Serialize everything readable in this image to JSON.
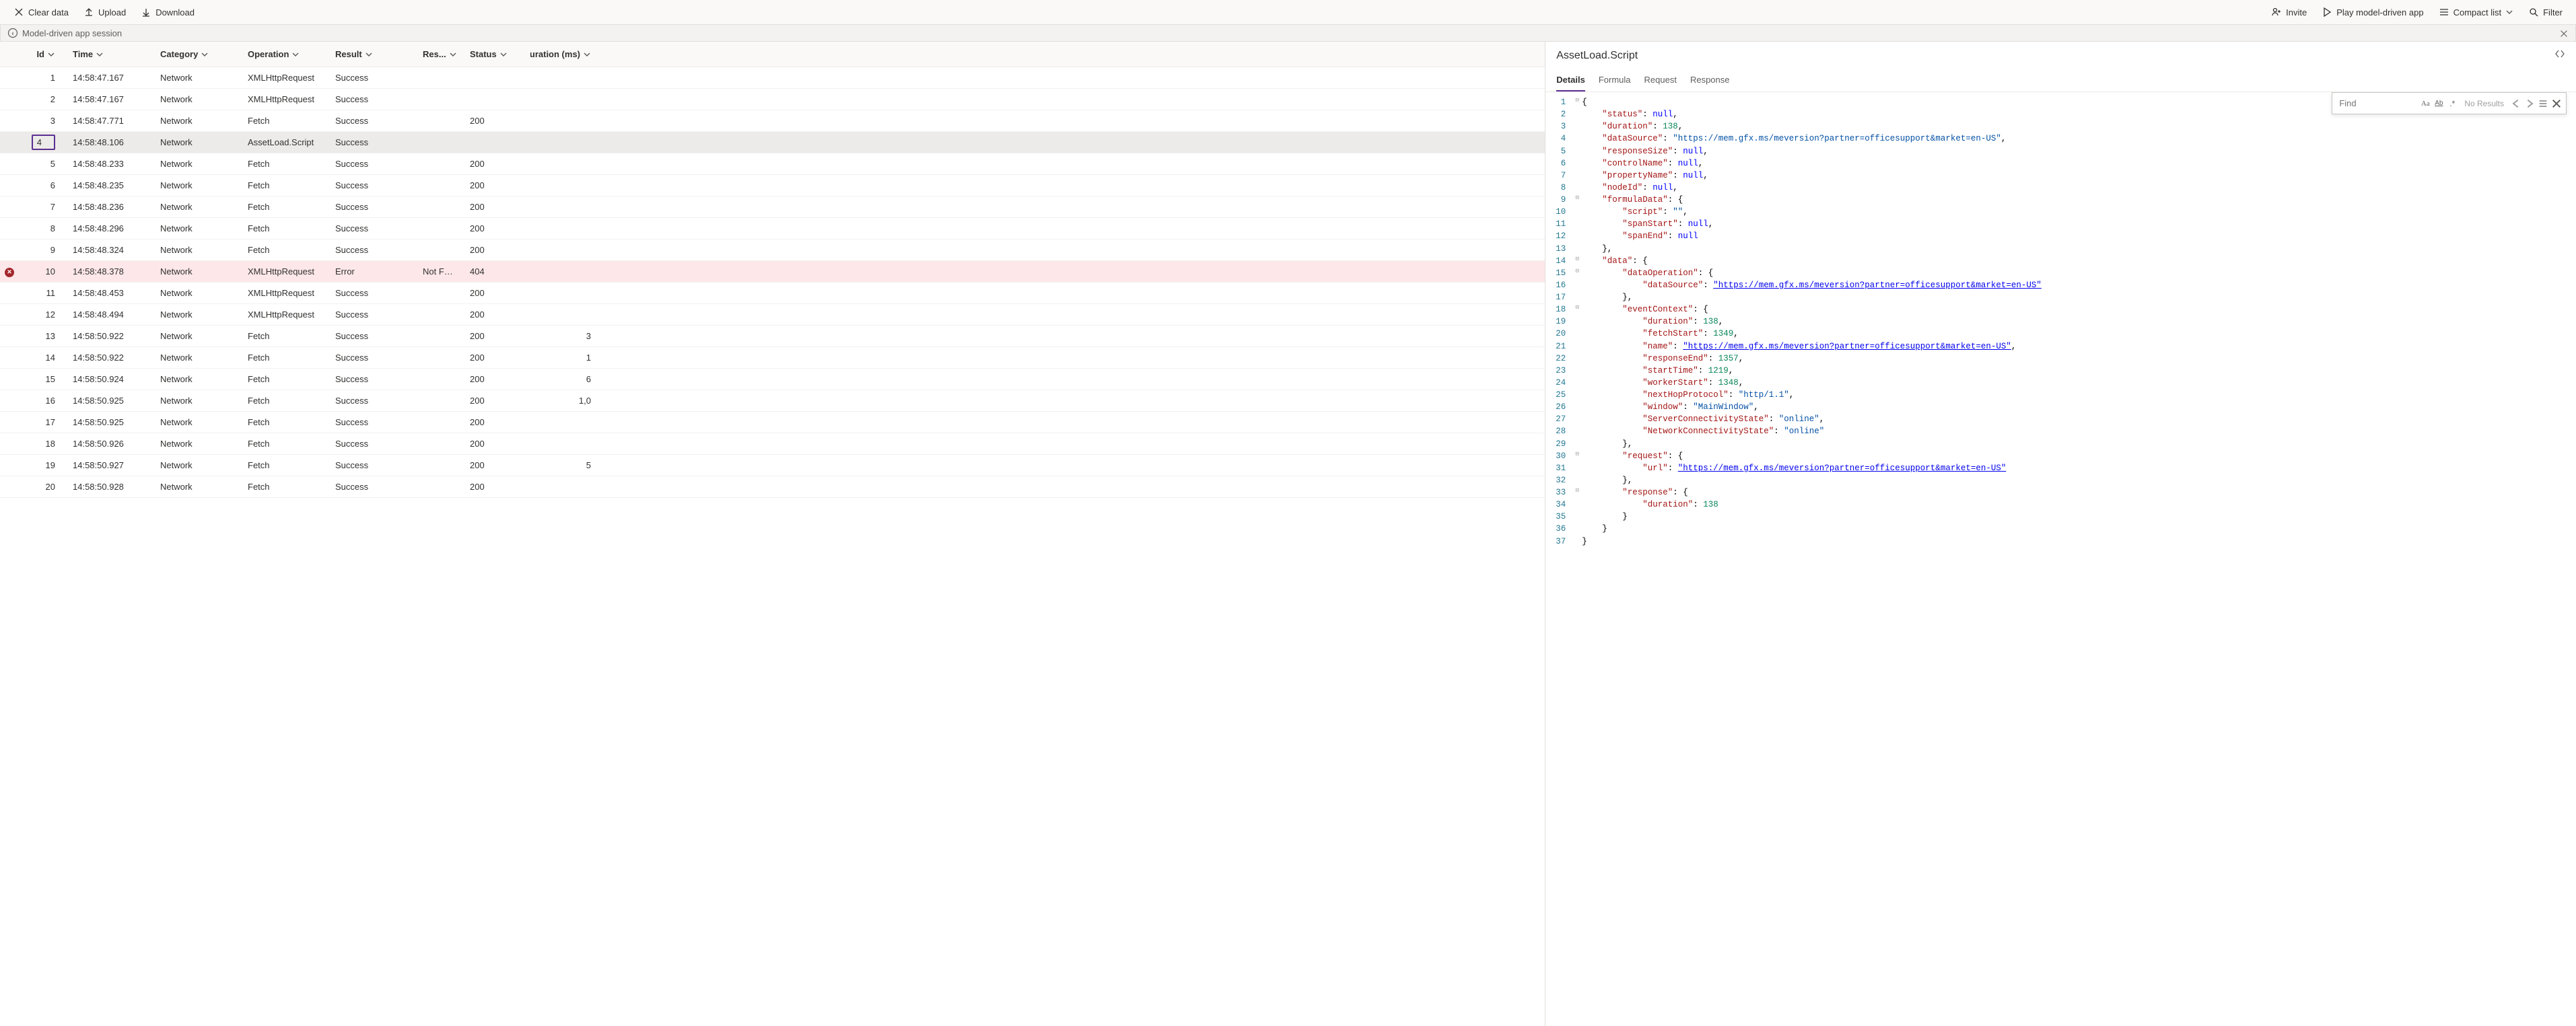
{
  "toolbar": {
    "clear": "Clear data",
    "upload": "Upload",
    "download": "Download",
    "invite": "Invite",
    "play": "Play model-driven app",
    "compact": "Compact list",
    "filter": "Filter"
  },
  "session": {
    "label": "Model-driven app session"
  },
  "columns": {
    "id": "Id",
    "time": "Time",
    "category": "Category",
    "operation": "Operation",
    "result": "Result",
    "reason": "Res...",
    "status": "Status",
    "duration": "Duration (ms)"
  },
  "rows": [
    {
      "id": "1",
      "time": "14:58:47.167",
      "category": "Network",
      "operation": "XMLHttpRequest",
      "result": "Success",
      "reason": "",
      "status": "",
      "duration": "",
      "err": false,
      "sel": false
    },
    {
      "id": "2",
      "time": "14:58:47.167",
      "category": "Network",
      "operation": "XMLHttpRequest",
      "result": "Success",
      "reason": "",
      "status": "",
      "duration": "",
      "err": false,
      "sel": false
    },
    {
      "id": "3",
      "time": "14:58:47.771",
      "category": "Network",
      "operation": "Fetch",
      "result": "Success",
      "reason": "",
      "status": "200",
      "duration": "",
      "err": false,
      "sel": false
    },
    {
      "id": "4",
      "time": "14:58:48.106",
      "category": "Network",
      "operation": "AssetLoad.Script",
      "result": "Success",
      "reason": "",
      "status": "",
      "duration": "",
      "err": false,
      "sel": true
    },
    {
      "id": "5",
      "time": "14:58:48.233",
      "category": "Network",
      "operation": "Fetch",
      "result": "Success",
      "reason": "",
      "status": "200",
      "duration": "",
      "err": false,
      "sel": false
    },
    {
      "id": "6",
      "time": "14:58:48.235",
      "category": "Network",
      "operation": "Fetch",
      "result": "Success",
      "reason": "",
      "status": "200",
      "duration": "",
      "err": false,
      "sel": false
    },
    {
      "id": "7",
      "time": "14:58:48.236",
      "category": "Network",
      "operation": "Fetch",
      "result": "Success",
      "reason": "",
      "status": "200",
      "duration": "",
      "err": false,
      "sel": false
    },
    {
      "id": "8",
      "time": "14:58:48.296",
      "category": "Network",
      "operation": "Fetch",
      "result": "Success",
      "reason": "",
      "status": "200",
      "duration": "",
      "err": false,
      "sel": false
    },
    {
      "id": "9",
      "time": "14:58:48.324",
      "category": "Network",
      "operation": "Fetch",
      "result": "Success",
      "reason": "",
      "status": "200",
      "duration": "",
      "err": false,
      "sel": false
    },
    {
      "id": "10",
      "time": "14:58:48.378",
      "category": "Network",
      "operation": "XMLHttpRequest",
      "result": "Error",
      "reason": "Not Fou...",
      "status": "404",
      "duration": "",
      "err": true,
      "sel": false
    },
    {
      "id": "11",
      "time": "14:58:48.453",
      "category": "Network",
      "operation": "XMLHttpRequest",
      "result": "Success",
      "reason": "",
      "status": "200",
      "duration": "",
      "err": false,
      "sel": false
    },
    {
      "id": "12",
      "time": "14:58:48.494",
      "category": "Network",
      "operation": "XMLHttpRequest",
      "result": "Success",
      "reason": "",
      "status": "200",
      "duration": "",
      "err": false,
      "sel": false
    },
    {
      "id": "13",
      "time": "14:58:50.922",
      "category": "Network",
      "operation": "Fetch",
      "result": "Success",
      "reason": "",
      "status": "200",
      "duration": "3",
      "err": false,
      "sel": false
    },
    {
      "id": "14",
      "time": "14:58:50.922",
      "category": "Network",
      "operation": "Fetch",
      "result": "Success",
      "reason": "",
      "status": "200",
      "duration": "1",
      "err": false,
      "sel": false
    },
    {
      "id": "15",
      "time": "14:58:50.924",
      "category": "Network",
      "operation": "Fetch",
      "result": "Success",
      "reason": "",
      "status": "200",
      "duration": "6",
      "err": false,
      "sel": false
    },
    {
      "id": "16",
      "time": "14:58:50.925",
      "category": "Network",
      "operation": "Fetch",
      "result": "Success",
      "reason": "",
      "status": "200",
      "duration": "1,0",
      "err": false,
      "sel": false
    },
    {
      "id": "17",
      "time": "14:58:50.925",
      "category": "Network",
      "operation": "Fetch",
      "result": "Success",
      "reason": "",
      "status": "200",
      "duration": "",
      "err": false,
      "sel": false
    },
    {
      "id": "18",
      "time": "14:58:50.926",
      "category": "Network",
      "operation": "Fetch",
      "result": "Success",
      "reason": "",
      "status": "200",
      "duration": "",
      "err": false,
      "sel": false
    },
    {
      "id": "19",
      "time": "14:58:50.927",
      "category": "Network",
      "operation": "Fetch",
      "result": "Success",
      "reason": "",
      "status": "200",
      "duration": "5",
      "err": false,
      "sel": false
    },
    {
      "id": "20",
      "time": "14:58:50.928",
      "category": "Network",
      "operation": "Fetch",
      "result": "Success",
      "reason": "",
      "status": "200",
      "duration": "",
      "err": false,
      "sel": false
    }
  ],
  "panel": {
    "title": "AssetLoad.Script",
    "tabs": {
      "details": "Details",
      "formula": "Formula",
      "request": "Request",
      "response": "Response"
    },
    "find": {
      "placeholder": "Find",
      "noresults": "No Results"
    }
  },
  "code": [
    {
      "n": 1,
      "f": "⊟",
      "t": [
        [
          "punc",
          "{"
        ]
      ]
    },
    {
      "n": 2,
      "f": "",
      "t": [
        [
          "ind",
          "    "
        ],
        [
          "key",
          "\"status\""
        ],
        [
          "punc",
          ": "
        ],
        [
          "null",
          "null"
        ],
        [
          "punc",
          ","
        ]
      ]
    },
    {
      "n": 3,
      "f": "",
      "t": [
        [
          "ind",
          "    "
        ],
        [
          "key",
          "\"duration\""
        ],
        [
          "punc",
          ": "
        ],
        [
          "num",
          "138"
        ],
        [
          "punc",
          ","
        ]
      ]
    },
    {
      "n": 4,
      "f": "",
      "t": [
        [
          "ind",
          "    "
        ],
        [
          "key",
          "\"dataSource\""
        ],
        [
          "punc",
          ": "
        ],
        [
          "str",
          "\"https://mem.gfx.ms/meversion?partner=officesupport&market=en-US\""
        ],
        [
          "punc",
          ","
        ]
      ]
    },
    {
      "n": 5,
      "f": "",
      "t": [
        [
          "ind",
          "    "
        ],
        [
          "key",
          "\"responseSize\""
        ],
        [
          "punc",
          ": "
        ],
        [
          "null",
          "null"
        ],
        [
          "punc",
          ","
        ]
      ]
    },
    {
      "n": 6,
      "f": "",
      "t": [
        [
          "ind",
          "    "
        ],
        [
          "key",
          "\"controlName\""
        ],
        [
          "punc",
          ": "
        ],
        [
          "null",
          "null"
        ],
        [
          "punc",
          ","
        ]
      ]
    },
    {
      "n": 7,
      "f": "",
      "t": [
        [
          "ind",
          "    "
        ],
        [
          "key",
          "\"propertyName\""
        ],
        [
          "punc",
          ": "
        ],
        [
          "null",
          "null"
        ],
        [
          "punc",
          ","
        ]
      ]
    },
    {
      "n": 8,
      "f": "",
      "t": [
        [
          "ind",
          "    "
        ],
        [
          "key",
          "\"nodeId\""
        ],
        [
          "punc",
          ": "
        ],
        [
          "null",
          "null"
        ],
        [
          "punc",
          ","
        ]
      ]
    },
    {
      "n": 9,
      "f": "⊟",
      "t": [
        [
          "ind",
          "    "
        ],
        [
          "key",
          "\"formulaData\""
        ],
        [
          "punc",
          ": {"
        ]
      ]
    },
    {
      "n": 10,
      "f": "",
      "t": [
        [
          "ind",
          "        "
        ],
        [
          "key",
          "\"script\""
        ],
        [
          "punc",
          ": "
        ],
        [
          "str",
          "\"\""
        ],
        [
          "punc",
          ","
        ]
      ]
    },
    {
      "n": 11,
      "f": "",
      "t": [
        [
          "ind",
          "        "
        ],
        [
          "key",
          "\"spanStart\""
        ],
        [
          "punc",
          ": "
        ],
        [
          "null",
          "null"
        ],
        [
          "punc",
          ","
        ]
      ]
    },
    {
      "n": 12,
      "f": "",
      "t": [
        [
          "ind",
          "        "
        ],
        [
          "key",
          "\"spanEnd\""
        ],
        [
          "punc",
          ": "
        ],
        [
          "null",
          "null"
        ]
      ]
    },
    {
      "n": 13,
      "f": "",
      "t": [
        [
          "ind",
          "    "
        ],
        [
          "punc",
          "},"
        ]
      ]
    },
    {
      "n": 14,
      "f": "⊟",
      "t": [
        [
          "ind",
          "    "
        ],
        [
          "key",
          "\"data\""
        ],
        [
          "punc",
          ": {"
        ]
      ]
    },
    {
      "n": 15,
      "f": "⊟",
      "t": [
        [
          "ind",
          "        "
        ],
        [
          "key",
          "\"dataOperation\""
        ],
        [
          "punc",
          ": {"
        ]
      ]
    },
    {
      "n": 16,
      "f": "",
      "t": [
        [
          "ind",
          "            "
        ],
        [
          "key",
          "\"dataSource\""
        ],
        [
          "punc",
          ": "
        ],
        [
          "url",
          "\"https://mem.gfx.ms/meversion?partner=officesupport&market=en-US\""
        ]
      ]
    },
    {
      "n": 17,
      "f": "",
      "t": [
        [
          "ind",
          "        "
        ],
        [
          "punc",
          "},"
        ]
      ]
    },
    {
      "n": 18,
      "f": "⊟",
      "t": [
        [
          "ind",
          "        "
        ],
        [
          "key",
          "\"eventContext\""
        ],
        [
          "punc",
          ": {"
        ]
      ]
    },
    {
      "n": 19,
      "f": "",
      "t": [
        [
          "ind",
          "            "
        ],
        [
          "key",
          "\"duration\""
        ],
        [
          "punc",
          ": "
        ],
        [
          "num",
          "138"
        ],
        [
          "punc",
          ","
        ]
      ]
    },
    {
      "n": 20,
      "f": "",
      "t": [
        [
          "ind",
          "            "
        ],
        [
          "key",
          "\"fetchStart\""
        ],
        [
          "punc",
          ": "
        ],
        [
          "num",
          "1349"
        ],
        [
          "punc",
          ","
        ]
      ]
    },
    {
      "n": 21,
      "f": "",
      "t": [
        [
          "ind",
          "            "
        ],
        [
          "key",
          "\"name\""
        ],
        [
          "punc",
          ": "
        ],
        [
          "url",
          "\"https://mem.gfx.ms/meversion?partner=officesupport&market=en-US\""
        ],
        [
          "punc",
          ","
        ]
      ]
    },
    {
      "n": 22,
      "f": "",
      "t": [
        [
          "ind",
          "            "
        ],
        [
          "key",
          "\"responseEnd\""
        ],
        [
          "punc",
          ": "
        ],
        [
          "num",
          "1357"
        ],
        [
          "punc",
          ","
        ]
      ]
    },
    {
      "n": 23,
      "f": "",
      "t": [
        [
          "ind",
          "            "
        ],
        [
          "key",
          "\"startTime\""
        ],
        [
          "punc",
          ": "
        ],
        [
          "num",
          "1219"
        ],
        [
          "punc",
          ","
        ]
      ]
    },
    {
      "n": 24,
      "f": "",
      "t": [
        [
          "ind",
          "            "
        ],
        [
          "key",
          "\"workerStart\""
        ],
        [
          "punc",
          ": "
        ],
        [
          "num",
          "1348"
        ],
        [
          "punc",
          ","
        ]
      ]
    },
    {
      "n": 25,
      "f": "",
      "t": [
        [
          "ind",
          "            "
        ],
        [
          "key",
          "\"nextHopProtocol\""
        ],
        [
          "punc",
          ": "
        ],
        [
          "str",
          "\"http/1.1\""
        ],
        [
          "punc",
          ","
        ]
      ]
    },
    {
      "n": 26,
      "f": "",
      "t": [
        [
          "ind",
          "            "
        ],
        [
          "key",
          "\"window\""
        ],
        [
          "punc",
          ": "
        ],
        [
          "str",
          "\"MainWindow\""
        ],
        [
          "punc",
          ","
        ]
      ]
    },
    {
      "n": 27,
      "f": "",
      "t": [
        [
          "ind",
          "            "
        ],
        [
          "key",
          "\"ServerConnectivityState\""
        ],
        [
          "punc",
          ": "
        ],
        [
          "str",
          "\"online\""
        ],
        [
          "punc",
          ","
        ]
      ]
    },
    {
      "n": 28,
      "f": "",
      "t": [
        [
          "ind",
          "            "
        ],
        [
          "key",
          "\"NetworkConnectivityState\""
        ],
        [
          "punc",
          ": "
        ],
        [
          "str",
          "\"online\""
        ]
      ]
    },
    {
      "n": 29,
      "f": "",
      "t": [
        [
          "ind",
          "        "
        ],
        [
          "punc",
          "},"
        ]
      ]
    },
    {
      "n": 30,
      "f": "⊟",
      "t": [
        [
          "ind",
          "        "
        ],
        [
          "key",
          "\"request\""
        ],
        [
          "punc",
          ": {"
        ]
      ]
    },
    {
      "n": 31,
      "f": "",
      "t": [
        [
          "ind",
          "            "
        ],
        [
          "key",
          "\"url\""
        ],
        [
          "punc",
          ": "
        ],
        [
          "url",
          "\"https://mem.gfx.ms/meversion?partner=officesupport&market=en-US\""
        ]
      ]
    },
    {
      "n": 32,
      "f": "",
      "t": [
        [
          "ind",
          "        "
        ],
        [
          "punc",
          "},"
        ]
      ]
    },
    {
      "n": 33,
      "f": "⊟",
      "t": [
        [
          "ind",
          "        "
        ],
        [
          "key",
          "\"response\""
        ],
        [
          "punc",
          ": {"
        ]
      ]
    },
    {
      "n": 34,
      "f": "",
      "t": [
        [
          "ind",
          "            "
        ],
        [
          "key",
          "\"duration\""
        ],
        [
          "punc",
          ": "
        ],
        [
          "num",
          "138"
        ]
      ]
    },
    {
      "n": 35,
      "f": "",
      "t": [
        [
          "ind",
          "        "
        ],
        [
          "punc",
          "}"
        ]
      ]
    },
    {
      "n": 36,
      "f": "",
      "t": [
        [
          "ind",
          "    "
        ],
        [
          "punc",
          "}"
        ]
      ]
    },
    {
      "n": 37,
      "f": "",
      "t": [
        [
          "punc",
          "}"
        ]
      ]
    }
  ]
}
